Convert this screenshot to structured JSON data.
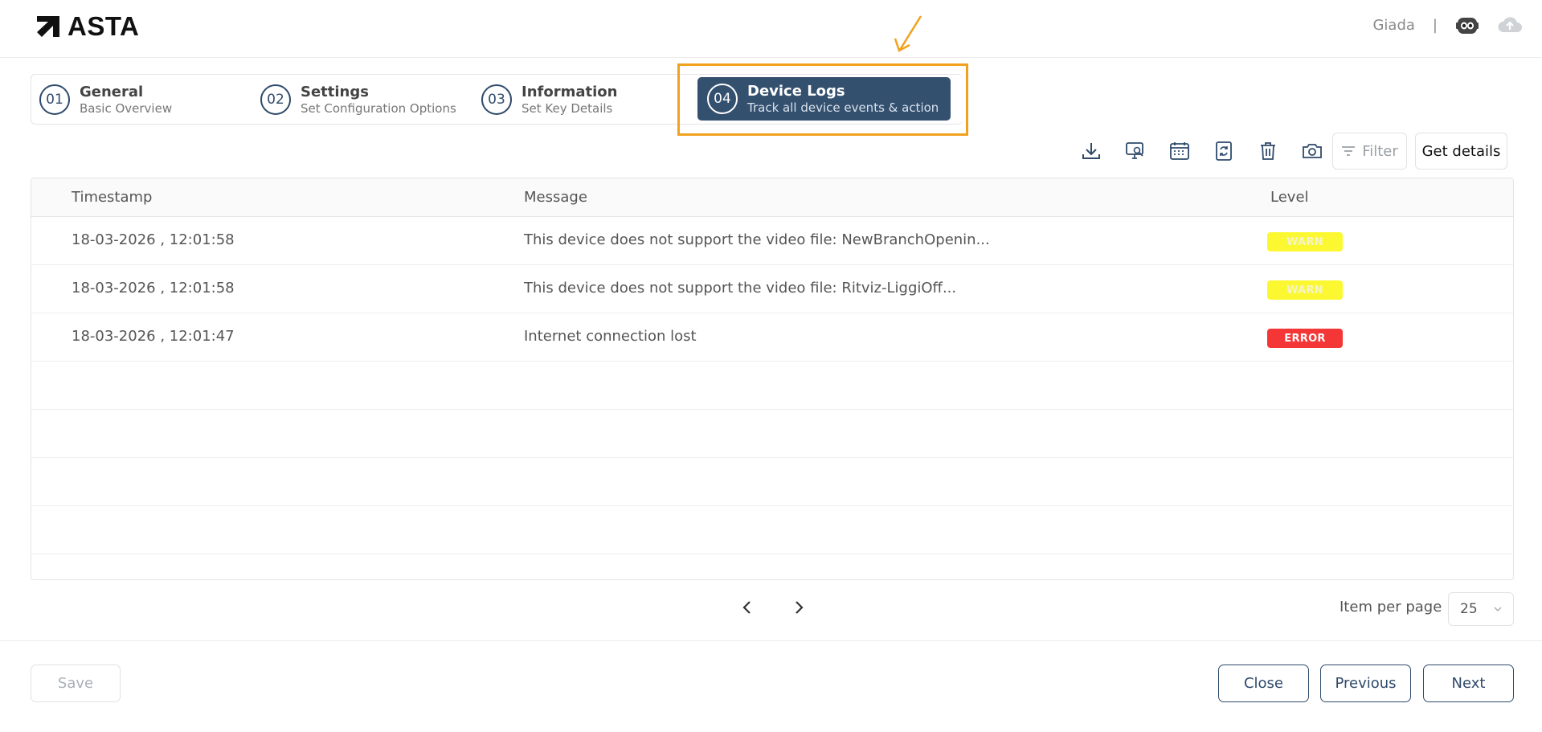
{
  "app": {
    "brand": "ASTA"
  },
  "header": {
    "user_name": "Giada",
    "separator": "|",
    "avatar_icon": "robot-avatar-icon",
    "cloud_icon": "cloud-upload-icon"
  },
  "colors": {
    "primary": "#34506f",
    "highlight": "#f2a11f",
    "warn": "#fbf831",
    "error": "#f53636"
  },
  "stepper": {
    "steps": [
      {
        "number": "01",
        "title": "General",
        "subtitle": "Basic Overview"
      },
      {
        "number": "02",
        "title": "Settings",
        "subtitle": "Set Configuration Options"
      },
      {
        "number": "03",
        "title": "Information",
        "subtitle": "Set Key Details"
      },
      {
        "number": "04",
        "title": "Device Logs",
        "subtitle": "Track all device events & action",
        "active": true
      }
    ]
  },
  "toolbar": {
    "icons": [
      "download-icon",
      "monitor-screenshot-icon",
      "calendar-icon",
      "refresh-icon",
      "trash-icon",
      "camera-icon"
    ],
    "filter_label": "Filter",
    "details_label": "Get details"
  },
  "table": {
    "columns": [
      "Timestamp",
      "Message",
      "Level"
    ],
    "rows": [
      {
        "timestamp": "18-03-2026 , 12:01:58",
        "message": "This device does not support the video file: NewBranchOpenin...",
        "level": "WARN"
      },
      {
        "timestamp": "18-03-2026 , 12:01:58",
        "message": "This device does not support the video file: Ritviz-LiggiOff...",
        "level": "WARN"
      },
      {
        "timestamp": "18-03-2026 , 12:01:47",
        "message": "Internet connection lost",
        "level": "ERROR"
      }
    ]
  },
  "pagination": {
    "per_page_label": "Item per page",
    "per_page_value": "25"
  },
  "footer": {
    "save_label": "Save",
    "close_label": "Close",
    "previous_label": "Previous",
    "next_label": "Next"
  }
}
